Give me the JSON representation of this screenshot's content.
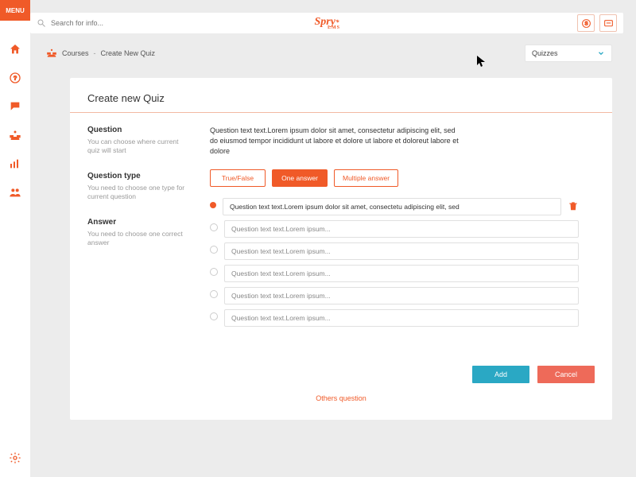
{
  "menu_label": "MENU",
  "search_placeholder": "Search for info...",
  "brand": {
    "name": "Spry",
    "sub": "LMS"
  },
  "breadcrumb": {
    "root": "Courses",
    "current": "Create New Quiz"
  },
  "dropdown_selected": "Quizzes",
  "card_title": "Create new Quiz",
  "sections": {
    "question": {
      "title": "Question",
      "help": "You can choose where current quiz will start"
    },
    "qtype": {
      "title": "Question type",
      "help": "You need to choose one type for current question"
    },
    "answer": {
      "title": "Answer",
      "help": "You need to choose one correct answer"
    }
  },
  "question_text": "Question text text.Lorem ipsum dolor sit amet, consectetur adipiscing elit, sed do eiusmod tempor incididunt ut labore et dolore ut labore et doloreut labore et dolore",
  "types": {
    "tf": "True/False",
    "one": "One answer",
    "multi": "Multiple answer",
    "active": "one"
  },
  "answers": [
    {
      "text": "Question text text.Lorem ipsum dolor sit amet, consectetu adipiscing elit, sed",
      "selected": true
    },
    {
      "text": "Question text text.Lorem ipsum...",
      "selected": false
    },
    {
      "text": "Question text text.Lorem ipsum...",
      "selected": false
    },
    {
      "text": "Question text text.Lorem ipsum...",
      "selected": false
    },
    {
      "text": "Question text text.Lorem ipsum...",
      "selected": false
    },
    {
      "text": "Question text text.Lorem ipsum...",
      "selected": false
    }
  ],
  "others_label": "Others question",
  "buttons": {
    "add": "Add",
    "cancel": "Cancel"
  }
}
